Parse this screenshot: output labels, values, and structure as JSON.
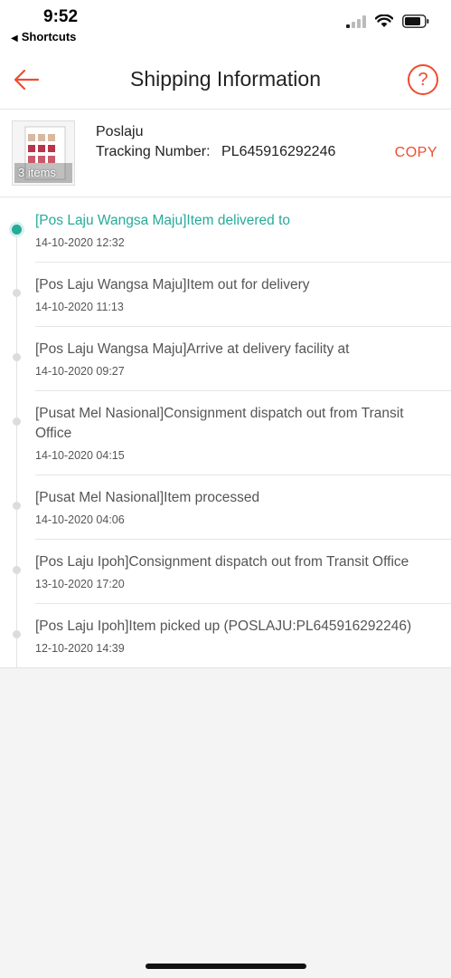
{
  "status_bar": {
    "time": "9:52",
    "back_app": "Shortcuts"
  },
  "nav": {
    "title": "Shipping Information",
    "help": "?"
  },
  "shipment": {
    "thumb_label": "3 items",
    "carrier": "Poslaju",
    "tracking_label": "Tracking Number:",
    "tracking_number": "PL645916292246",
    "copy_label": "COPY"
  },
  "colors": {
    "accent": "#ee4d2d",
    "active": "#26aa99"
  },
  "events": [
    {
      "desc": "[Pos Laju Wangsa Maju]Item delivered to",
      "ts": "14-10-2020 12:32"
    },
    {
      "desc": "[Pos Laju Wangsa Maju]Item out for delivery",
      "ts": "14-10-2020 11:13"
    },
    {
      "desc": "[Pos Laju Wangsa Maju]Arrive at delivery facility at",
      "ts": "14-10-2020 09:27"
    },
    {
      "desc": "[Pusat Mel Nasional]Consignment dispatch out from Transit Office",
      "ts": "14-10-2020 04:15"
    },
    {
      "desc": "[Pusat Mel Nasional]Item processed",
      "ts": "14-10-2020 04:06"
    },
    {
      "desc": "[Pos Laju Ipoh]Consignment dispatch out from Transit Office",
      "ts": "13-10-2020 17:20"
    },
    {
      "desc": "[Pos Laju Ipoh]Item picked up (POSLAJU:PL645916292246)",
      "ts": "12-10-2020 14:39"
    }
  ]
}
